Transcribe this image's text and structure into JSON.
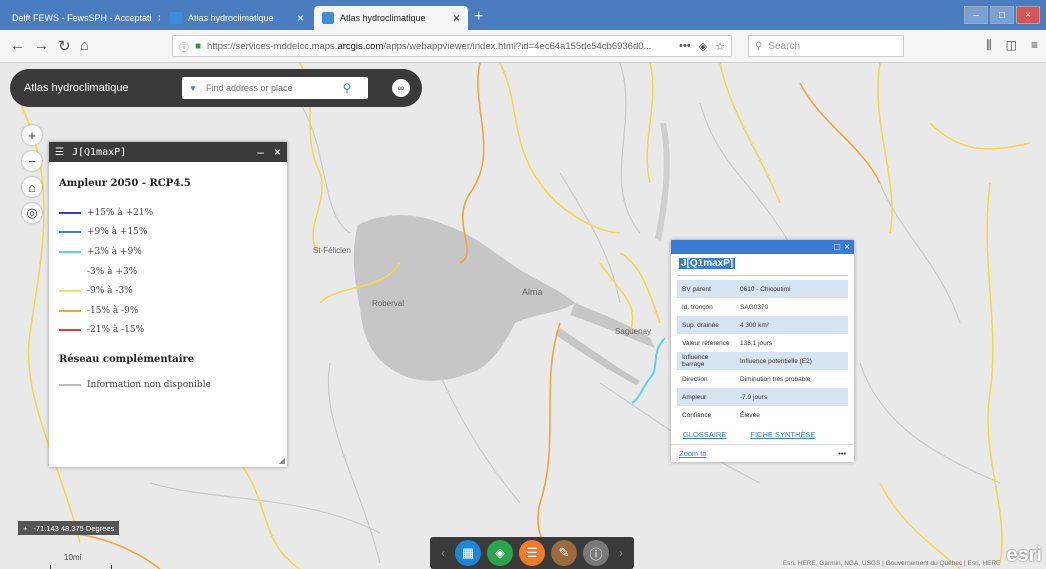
{
  "browser": {
    "tabs": [
      {
        "label": "Delft FEWS - FewsSPH - Acceptati",
        "active": false
      },
      {
        "label": "Atlas hydroclimatique",
        "active": false
      },
      {
        "label": "Atlas hydroclimatique",
        "active": true
      }
    ],
    "url_prefix": "https://services-mddelcc.maps.",
    "url_domain": "arcgis.com",
    "url_suffix": "/apps/webappviewer/index.html?id=4ec64a155dc54cb6936d0...",
    "search_placeholder": "Search",
    "url_menu_label": "•••"
  },
  "app": {
    "title": "Atlas hydroclimatique",
    "find_placeholder": "Find address or place"
  },
  "map_labels": {
    "st_felicien": "St-Félicien",
    "roberval": "Roberval",
    "alma": "Alma",
    "saguenay": "Saguenay"
  },
  "zoom": {
    "in": "+",
    "out": "−"
  },
  "legend": {
    "header": "J[Q1maxP]",
    "title": "Ampleur 2050 - RCP4.5",
    "items": [
      {
        "label": "+15% à +21%",
        "color": "#2b3fd1"
      },
      {
        "label": "+9% à +15%",
        "color": "#3f7fd6"
      },
      {
        "label": "+3% à +9%",
        "color": "#56d4f0"
      },
      {
        "label": "-3% à +3%",
        "color": "#ffffff"
      },
      {
        "label": "-9% à -3%",
        "color": "#f2e15a"
      },
      {
        "label": "-15% à -9%",
        "color": "#f2a53a"
      },
      {
        "label": "-21% à -15%",
        "color": "#e23b3b"
      }
    ],
    "subtitle": "Réseau complémentaire",
    "sub_item": {
      "label": "Information non disponible",
      "color": "#bdbdbd"
    }
  },
  "popup": {
    "title": "J[Q1maxP]",
    "rows": [
      {
        "key": "BV parent",
        "value": "0610 - Chicoutimi"
      },
      {
        "key": "Id. tronçon",
        "value": "SAG0370"
      },
      {
        "key": "Sup. drainée",
        "value": "4 300 km²"
      },
      {
        "key": "Valeur référence",
        "value": "138.1 jours"
      },
      {
        "key": "Influence barrage",
        "value": "Influence potentielle (E2)"
      },
      {
        "key": "Direction",
        "value": "Diminution très probable"
      },
      {
        "key": "Ampleur",
        "value": "-7.9 jours"
      },
      {
        "key": "Confiance",
        "value": "Élevée"
      }
    ],
    "link_glossaire": "GLOSSAIRE",
    "link_fiche": "FICHE SYNTHÈSE",
    "zoom_to": "Zoom to",
    "more": "•••"
  },
  "coords": "-71.143 48.375 Degrees",
  "scale": "10mi",
  "attribution": "Esri, HERE, Garmin, NGA, USGS | Gouvernement du Québec | Esri, HERE",
  "esri_logo": "esri",
  "toolbar_colors": {
    "grid": "#1b87d6",
    "layers": "#2aa54a",
    "legend": "#f0792b",
    "draw": "#9b6b3e",
    "info": "#7a7a7a"
  }
}
